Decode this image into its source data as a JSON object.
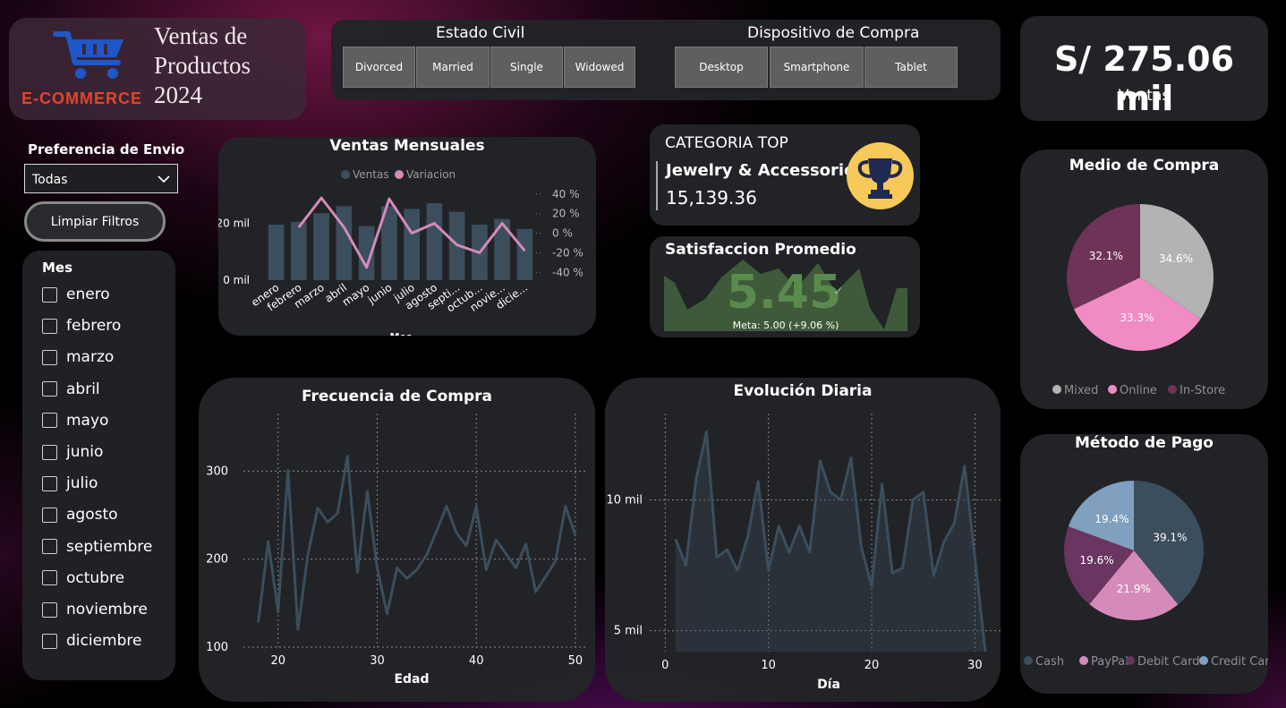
{
  "header": {
    "logo_text": "E-COMMERCE",
    "title_lines": [
      "Ventas de",
      "Productos",
      "2024"
    ]
  },
  "filters": {
    "estado_civil": {
      "label": "Estado Civil",
      "options": [
        "Divorced",
        "Married",
        "Single",
        "Widowed"
      ]
    },
    "dispositivo": {
      "label": "Dispositivo de Compra",
      "options": [
        "Desktop",
        "Smartphone",
        "Tablet"
      ]
    }
  },
  "kpi": {
    "value": "S/ 275.06 mil",
    "label": "Ventas"
  },
  "envio": {
    "label": "Preferencia de Envio",
    "selected": "Todas"
  },
  "clear_button": "Limpiar Filtros",
  "mes_slicer": {
    "title": "Mes",
    "items": [
      "enero",
      "febrero",
      "marzo",
      "abril",
      "mayo",
      "junio",
      "julio",
      "agosto",
      "septiembre",
      "octubre",
      "noviembre",
      "diciembre"
    ]
  },
  "top_category": {
    "heading": "CATEGORIA TOP",
    "name": "Jewelry & Accessories",
    "value": "15,139.36",
    "icon": "trophy-icon"
  },
  "satisfaction": {
    "title": "Satisfaccion Promedio",
    "value": "5.45",
    "goal": "Meta: 5.00 (+9.06 %)",
    "color": "#3f5a3a"
  },
  "colors": {
    "bar": "#3b4e5e",
    "variation": "#d48ab8",
    "line": "#3b4e5e",
    "pie_mixed": "#b3b3b3",
    "pie_online": "#f08bc4",
    "pie_instore": "#6e3356",
    "pay_cash": "#3b4e5e",
    "pay_paypal": "#d58bb9",
    "pay_debit": "#6a3560",
    "pay_credit": "#7fa0bf"
  },
  "chart_data": [
    {
      "id": "ventas_mensuales",
      "type": "bar",
      "title": "Ventas Mensuales",
      "xlabel": "Mes",
      "categories": [
        "enero",
        "febrero",
        "marzo",
        "abril",
        "mayo",
        "junio",
        "julio",
        "agosto",
        "septi...",
        "octub...",
        "novie...",
        "dicie..."
      ],
      "tick_labels_left": [
        "0 mil",
        "20 mil"
      ],
      "tick_labels_right": [
        "40 %",
        "20 %",
        "0 %",
        "-20 %",
        "-40 %"
      ],
      "legend": [
        "Ventas",
        "Variacion"
      ],
      "ylim": [
        0,
        33
      ],
      "y2lim": [
        -48,
        48
      ],
      "series": [
        {
          "name": "Ventas",
          "values": [
            19.5,
            20.5,
            23.5,
            26,
            19,
            26,
            25,
            27,
            24,
            19.5,
            21.5,
            18
          ]
        },
        {
          "name": "Variacion",
          "values": [
            null,
            6,
            36,
            6,
            -35,
            35,
            0,
            10,
            -12,
            -20,
            10,
            -18
          ]
        }
      ]
    },
    {
      "id": "frecuencia_compra",
      "type": "line",
      "title": "Frecuencia de Compra",
      "xlabel": "Edad",
      "x_ticks": [
        20,
        30,
        40,
        50
      ],
      "y_ticks": [
        100,
        200,
        300
      ],
      "xlim": [
        16.5,
        51
      ],
      "ylim": [
        100,
        340
      ],
      "x": [
        18,
        19,
        20,
        21,
        22,
        23,
        24,
        25,
        26,
        27,
        28,
        29,
        30,
        31,
        32,
        33,
        34,
        35,
        36,
        37,
        38,
        39,
        40,
        41,
        42,
        43,
        44,
        45,
        46,
        47,
        48,
        49,
        50
      ],
      "values": [
        128,
        220,
        140,
        301,
        120,
        205,
        258,
        242,
        252,
        317,
        185,
        277,
        190,
        138,
        190,
        178,
        188,
        205,
        232,
        260,
        230,
        215,
        260,
        188,
        222,
        206,
        190,
        217,
        163,
        180,
        198,
        260,
        227
      ]
    },
    {
      "id": "evolucion_diaria",
      "type": "area",
      "title": "Evolución Diaria",
      "xlabel": "Día",
      "x_ticks": [
        0,
        10,
        20,
        30
      ],
      "y_ticks": [
        "5 mil",
        "10 mil"
      ],
      "xlim": [
        -1.5,
        33
      ],
      "ylim": [
        4.2,
        13.3
      ],
      "x": [
        1,
        2,
        3,
        4,
        5,
        6,
        7,
        8,
        9,
        10,
        11,
        12,
        13,
        14,
        15,
        16,
        17,
        18,
        19,
        20,
        21,
        22,
        23,
        24,
        25,
        26,
        27,
        28,
        29,
        30,
        31
      ],
      "values": [
        8.5,
        7.5,
        10.8,
        12.6,
        7.8,
        8.1,
        7.3,
        8.6,
        10.7,
        7.3,
        9.0,
        8.0,
        9.0,
        8.0,
        11.5,
        10.3,
        10.0,
        11.6,
        8.2,
        6.7,
        10.6,
        7.2,
        7.4,
        10.0,
        10.3,
        7.1,
        8.4,
        9.1,
        11.3,
        7.8,
        4.2
      ]
    },
    {
      "id": "medio_compra",
      "type": "pie",
      "title": "Medio de Compra",
      "legend": [
        "Mixed",
        "Online",
        "In-Store"
      ],
      "labels": [
        "Mixed",
        "Online",
        "In-Store"
      ],
      "values": [
        34.6,
        33.3,
        32.1
      ],
      "value_labels": [
        "34.6%",
        "33.3%",
        "32.1%"
      ]
    },
    {
      "id": "metodo_pago",
      "type": "pie",
      "title": "Método de Pago",
      "legend": [
        "Cash",
        "PayPal",
        "Debit Card",
        "Credit Card"
      ],
      "labels": [
        "Cash",
        "PayPal",
        "Debit Card",
        "Credit Card"
      ],
      "values": [
        39.1,
        21.9,
        19.6,
        19.4
      ],
      "value_labels": [
        "39.1%",
        "21.9%",
        "19.6%",
        "19.4%"
      ]
    }
  ]
}
